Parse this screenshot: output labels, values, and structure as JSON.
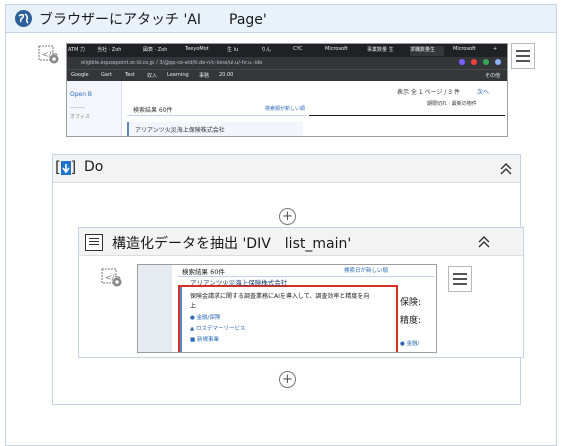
{
  "outer_scope": {
    "title": "ブラウザーにアタッチ 'AI　　Page'",
    "icon": "globe-icon"
  },
  "browser_preview": {
    "tabs": [
      "ATM 力",
      "当社 · Zoh",
      "図表 · Zoh",
      "TeeyoMot",
      "生 lu",
      "りん",
      "CYC",
      "Microsoft",
      "事業数量 生",
      "求職数量生",
      "Microsoft",
      "+"
    ],
    "url": "eligible.equsepoint.or.ld.co.jp / 3/@pp-ce-eld/ti.de-n/c-lone/ui.u/-hr.u.-ide",
    "bookmarks": [
      "Google",
      "Gart",
      "Test",
      "収入",
      "Learning",
      "事務",
      "20.00"
    ],
    "bookmark_right": "その他",
    "sidebar_label": "Open B",
    "sidebar_sub": "ーーー",
    "sidebar_sub2": "オフィス",
    "result_count": "検索結果 60件",
    "sort_link": "検索順が新しい順",
    "pager_text": "表示 全 1 ページ / 3 件",
    "pager_link": "次へ",
    "pager_right": "ページ設定",
    "filter_text": "期限切れ · 最新の物件",
    "company": "アリアンツ火災海上保険株式会社"
  },
  "do_scope": {
    "label": "Do",
    "collapse_icon": "chevron-double-up-icon"
  },
  "extract_action": {
    "title": "構造化データを抽出 'DIV　list_main'",
    "collapse_icon": "chevron-double-up-icon"
  },
  "element_preview": {
    "result_count": "検索結果 60件",
    "sort_link": "検索日が新しい順",
    "company": "アリアンツ火災海上保険株式会社",
    "description_line1": "保険金請求に関する調査業務にAIを導入して、調査効率と精度を向",
    "description_line2": "上",
    "bullets": [
      "● 金融/保険",
      "▲ ロスデマーリービス",
      "■ 新規事業"
    ],
    "side_text_1": "保険:",
    "side_text_2": "精度:",
    "side_bullet": "● 金融/"
  },
  "colors": {
    "accent": "#2d5f9a",
    "scope_border": "#c7d4e4",
    "highlight": "#d93025"
  }
}
